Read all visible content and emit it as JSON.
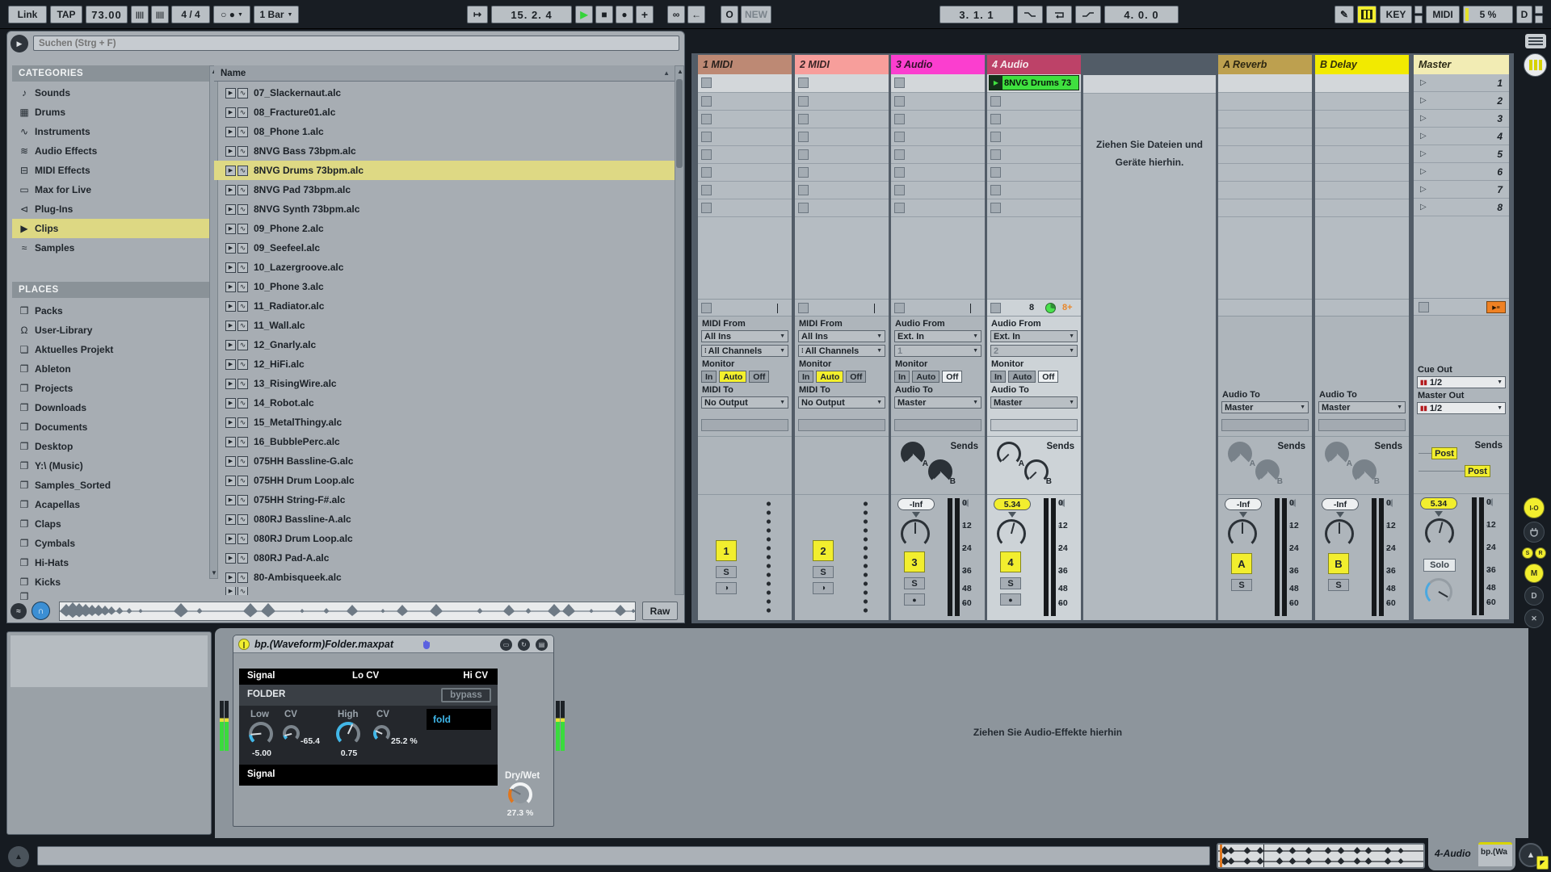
{
  "colors": {
    "accent_yellow": "#f2ee2e",
    "clip_green": "#3fe03f",
    "meter_green": "#3ddc3f",
    "meter_red": "#e01418",
    "track1": "#bd8974",
    "track2": "#f79e9b",
    "track3": "#fb3ecf",
    "track4": "#bd4268",
    "returnA": "#bda04f",
    "returnB": "#f2ea00",
    "master": "#f2ecb4",
    "device_blue": "#42b7e8",
    "drywet_orange": "#e0761e"
  },
  "transport": {
    "link": "Link",
    "tap": "TAP",
    "tempo": "73.00",
    "nudge_down": "||||",
    "nudge_up": "||||",
    "time_sig": "4 / 4",
    "metronome": "○ ●",
    "quantize": "1 Bar",
    "follow": "↦",
    "position": "15.  2.  4",
    "play": "▶",
    "stop": "■",
    "record": "●",
    "overdub": "+",
    "session_record": "∞",
    "back_to_arr": "←",
    "automation_arm": "O",
    "new_label": "NEW",
    "loop_start": "3.  1.  1",
    "loop_length": "4.  0.  0",
    "draw": "✎",
    "key_label": "KEY",
    "midi_label": "MIDI",
    "cpu_load": "5 %",
    "disk": "D"
  },
  "browser": {
    "search_placeholder": "Suchen (Strg + F)",
    "categories_title": "CATEGORIES",
    "categories": [
      {
        "icon": "♪",
        "label": "Sounds"
      },
      {
        "icon": "▦",
        "label": "Drums"
      },
      {
        "icon": "∿",
        "label": "Instruments"
      },
      {
        "icon": "≋",
        "label": "Audio Effects"
      },
      {
        "icon": "⊟",
        "label": "MIDI Effects"
      },
      {
        "icon": "▭",
        "label": "Max for Live"
      },
      {
        "icon": "⊲",
        "label": "Plug-Ins"
      },
      {
        "icon": "▶",
        "label": "Clips"
      },
      {
        "icon": "≈",
        "label": "Samples"
      }
    ],
    "selected_category_index": 7,
    "places_title": "PLACES",
    "places": [
      {
        "icon": "❒",
        "label": "Packs"
      },
      {
        "icon": "Ω",
        "label": "User-Library"
      },
      {
        "icon": "❏",
        "label": "Aktuelles Projekt"
      },
      {
        "icon": "❐",
        "label": "Ableton"
      },
      {
        "icon": "❐",
        "label": "Projects"
      },
      {
        "icon": "❐",
        "label": "Downloads"
      },
      {
        "icon": "❐",
        "label": "Documents"
      },
      {
        "icon": "❐",
        "label": "Desktop"
      },
      {
        "icon": "❐",
        "label": "Y:\\ (Music)"
      },
      {
        "icon": "❐",
        "label": "Samples_Sorted"
      },
      {
        "icon": "❐",
        "label": "Acapellas"
      },
      {
        "icon": "❐",
        "label": "Claps"
      },
      {
        "icon": "❐",
        "label": "Cymbals"
      },
      {
        "icon": "❐",
        "label": "Hi-Hats"
      },
      {
        "icon": "❐",
        "label": "Kicks"
      }
    ],
    "name_header": "Name",
    "files": [
      {
        "name": "07_Slackernaut.alc"
      },
      {
        "name": "08_Fracture01.alc"
      },
      {
        "name": "08_Phone 1.alc"
      },
      {
        "name": "8NVG Bass 73bpm.alc"
      },
      {
        "name": "8NVG Drums 73bpm.alc"
      },
      {
        "name": "8NVG Pad 73bpm.alc"
      },
      {
        "name": "8NVG Synth 73bpm.alc"
      },
      {
        "name": "09_Phone 2.alc"
      },
      {
        "name": "09_Seefeel.alc"
      },
      {
        "name": "10_Lazergroove.alc"
      },
      {
        "name": "10_Phone 3.alc"
      },
      {
        "name": "11_Radiator.alc"
      },
      {
        "name": "11_Wall.alc"
      },
      {
        "name": "12_Gnarly.alc"
      },
      {
        "name": "12_HiFi.alc"
      },
      {
        "name": "13_RisingWire.alc"
      },
      {
        "name": "14_Robot.alc"
      },
      {
        "name": "15_MetalThingy.alc"
      },
      {
        "name": "16_BubblePerc.alc"
      },
      {
        "name": "075HH Bassline-G.alc"
      },
      {
        "name": "075HH Drum Loop.alc"
      },
      {
        "name": "075HH String-F#.alc"
      },
      {
        "name": "080RJ Bassline-A.alc"
      },
      {
        "name": "080RJ Drum Loop.alc"
      },
      {
        "name": "080RJ Pad-A.alc"
      },
      {
        "name": "80-Ambisqueek.alc"
      }
    ],
    "selected_file_index": 4,
    "raw_button": "Raw"
  },
  "session": {
    "drop_hint_1": "Ziehen Sie Dateien und",
    "drop_hint_2": "Geräte hierhin.",
    "sends_label": "Sends",
    "meter_ticks": [
      "0",
      "12",
      "24",
      "36",
      "48",
      "60"
    ],
    "tracks": [
      {
        "name": "1 MIDI",
        "num": "1",
        "solo": "S",
        "arm": "◑",
        "io": {
          "from_label": "MIDI From",
          "from": "All Ins",
          "chan": "All Channels",
          "monitor_label": "Monitor",
          "m_in": "In",
          "m_auto": "Auto",
          "m_off": "Off",
          "to_label": "MIDI To",
          "to": "No Output"
        }
      },
      {
        "name": "2 MIDI",
        "num": "2",
        "solo": "S",
        "arm": "◑",
        "io": {
          "from_label": "MIDI From",
          "from": "All Ins",
          "chan": "All Channels",
          "monitor_label": "Monitor",
          "m_in": "In",
          "m_auto": "Auto",
          "m_off": "Off",
          "to_label": "MIDI To",
          "to": "No Output"
        }
      },
      {
        "name": "3 Audio",
        "num": "3",
        "solo": "S",
        "arm": "●",
        "vol": "-Inf",
        "io": {
          "from_label": "Audio From",
          "from": "Ext. In",
          "chan": "1",
          "monitor_label": "Monitor",
          "m_in": "In",
          "m_auto": "Auto",
          "m_off": "Off",
          "to_label": "Audio To",
          "to": "Master"
        }
      },
      {
        "name": "4 Audio",
        "num": "4",
        "solo": "S",
        "arm": "●",
        "vol": "5.34",
        "clip_name": "8NVG Drums 73",
        "status_count": "8",
        "status_loop": "8+",
        "io": {
          "from_label": "Audio From",
          "from": "Ext. In",
          "chan": "2",
          "monitor_label": "Monitor",
          "m_in": "In",
          "m_auto": "Auto",
          "m_off": "Off",
          "to_label": "Audio To",
          "to": "Master"
        }
      }
    ],
    "returns": [
      {
        "name": "A Reverb",
        "num": "A",
        "solo": "S",
        "vol": "-Inf",
        "to_label": "Audio To",
        "to": "Master"
      },
      {
        "name": "B Delay",
        "num": "B",
        "solo": "S",
        "vol": "-Inf",
        "to_label": "Audio To",
        "to": "Master"
      }
    ],
    "master": {
      "name": "Master",
      "scenes": [
        "1",
        "2",
        "3",
        "4",
        "5",
        "6",
        "7",
        "8"
      ],
      "cue_label": "Cue Out",
      "cue": "1/2",
      "out_label": "Master Out",
      "out": "1/2",
      "vol": "5.34",
      "solo": "Solo",
      "post_a": "Post",
      "post_b": "Post"
    }
  },
  "device": {
    "title": "bp.(Waveform)Folder.maxpat",
    "signal_in": "Signal",
    "lo_cv": "Lo CV",
    "hi_cv": "Hi CV",
    "folder": "FOLDER",
    "bypass": "bypass",
    "low_label": "Low",
    "cv1_label": "CV",
    "high_label": "High",
    "cv2_label": "CV",
    "low_val": "-5.00",
    "cv1_val": "-65.4",
    "high_val": "0.75",
    "cv2_val": "25.2 %",
    "fold": "fold",
    "signal_out": "Signal",
    "drywet_label": "Dry/Wet",
    "drywet_val": "27.3 %",
    "drop_hint": "Ziehen Sie Audio-Effekte hierhin"
  },
  "status": {
    "track_label": "4-Audio",
    "device_tab": "bp.(Wa"
  }
}
